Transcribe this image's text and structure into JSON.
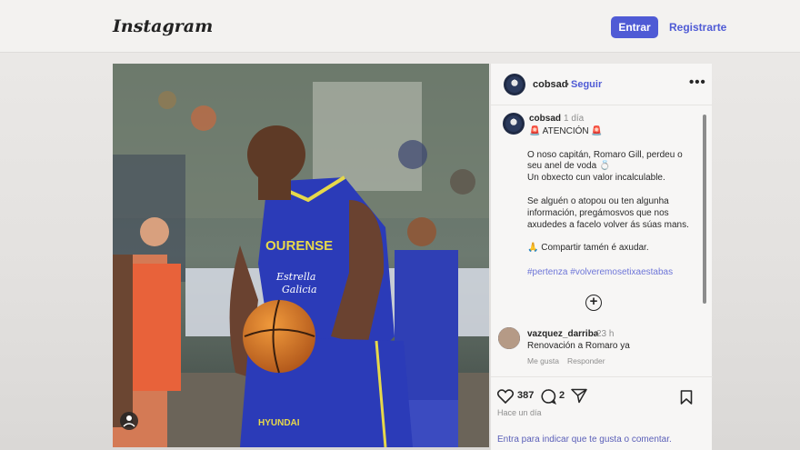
{
  "header": {
    "logo": "Instagram",
    "login_label": "Entrar",
    "signup_label": "Registrarte"
  },
  "post": {
    "author": "cobsad",
    "follow_separator": "•",
    "follow_label": "Seguir",
    "more_label": "•••",
    "time_ago": "1 día",
    "caption_lines": [
      "🚨 ATENCIÓN 🚨",
      "O noso capitán, Romaro Gill, perdeu o",
      "seu anel de voda 💍",
      "Un obxecto cun valor incalculable.",
      "Se alguén o atopou ou ten algunha",
      "información, pregámosvos que nos",
      "axudedes a facelo volver ás súas mans.",
      "🙏 Compartir tamén é axudar."
    ],
    "hashtags": "#pertenza #volveremosetixaestabas",
    "image_texts": {
      "jersey_team": "OURENSE",
      "jersey_sponsor_1": "Estrella",
      "jersey_sponsor_2": "Galicia",
      "shorts_sponsor": "HYUNDAI"
    }
  },
  "comment": {
    "user": "vazquez_darriba",
    "time": "23 h",
    "text": "Renovación a Romaro ya",
    "like_label": "Me gusta",
    "reply_label": "Responder"
  },
  "actions": {
    "likes": "387",
    "comments": "2",
    "posted": "Hace un día",
    "comment_placeholder": "Entra para indicar que te gusta o comentar."
  },
  "colors": {
    "accent": "#4f5bd5",
    "jersey": "#2b3bb8",
    "opponent_jersey": "#e8623a"
  }
}
